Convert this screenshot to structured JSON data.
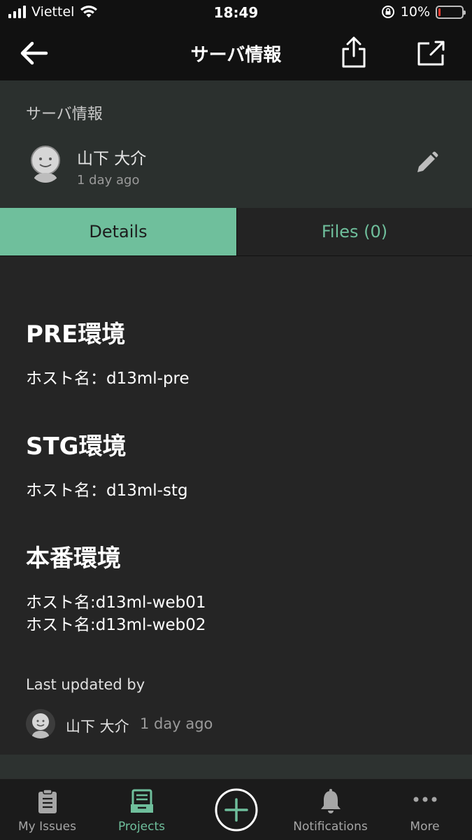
{
  "status_bar": {
    "carrier": "Viettel",
    "time": "18:49",
    "battery_percent": "10%",
    "battery_level": 0.1
  },
  "nav": {
    "title": "サーバ情報"
  },
  "issue": {
    "title": "サーバ情報",
    "author": "山下 大介",
    "time": "1 day ago"
  },
  "tabs": [
    {
      "label": "Details",
      "active": true
    },
    {
      "label": "Files (0)",
      "active": false
    }
  ],
  "content": {
    "sections": [
      {
        "heading": "PRE環境",
        "lines": [
          "ホスト名：d13ml-pre"
        ]
      },
      {
        "heading": "STG環境",
        "lines": [
          "ホスト名：d13ml-stg"
        ]
      },
      {
        "heading": "本番環境",
        "lines": [
          "ホスト名:d13ml-web01",
          "ホスト名:d13ml-web02"
        ]
      }
    ],
    "last_updated_label": "Last updated by",
    "last_updated_user": "山下 大介",
    "last_updated_time": "1 day ago"
  },
  "tab_bar": {
    "items": [
      {
        "label": "My Issues",
        "icon": "clipboard-icon",
        "active": false
      },
      {
        "label": "Projects",
        "icon": "projects-icon",
        "active": true
      },
      {
        "label": "",
        "icon": "add-circle-icon",
        "active": false
      },
      {
        "label": "Notifications",
        "icon": "bell-icon",
        "active": false
      },
      {
        "label": "More",
        "icon": "more-dots-icon",
        "active": false
      }
    ]
  },
  "colors": {
    "accent": "#6fbf9c",
    "header_bg": "#2b302e",
    "content_bg": "#252525"
  }
}
